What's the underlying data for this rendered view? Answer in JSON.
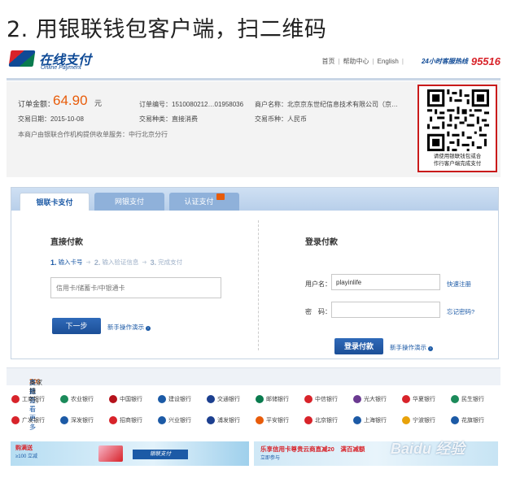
{
  "step_title": "2. 用银联钱包客户端，扫二维码",
  "header": {
    "logo_card_text": "UnionPay 银联",
    "logo_main": "在线支付",
    "logo_sub": "Online Payment",
    "links": [
      "首页",
      "帮助中心",
      "English"
    ],
    "hotline_label": "24小时客服热线",
    "hotline_number": "95516"
  },
  "order": {
    "amount_label": "订单金额：",
    "amount_value": "64.90",
    "amount_unit": "元",
    "order_no": "订单编号：1510080212…01958036",
    "merchant": "商户名称：北京京东世纪信息技术有限公司（京…",
    "date": "交易日期：2015-10-08",
    "type": "交易种类：直接消费",
    "currency": "交易币种：人民币",
    "notice": "本商户由银联合作机构提供收单服务：中行北京分行",
    "qr_caption_1": "请使用银联钱包或合",
    "qr_caption_2": "作行客户端完成支付"
  },
  "tabs": [
    {
      "label": "银联卡支付",
      "active": true
    },
    {
      "label": "网银支付",
      "active": false
    },
    {
      "label": "认证支付",
      "active": false
    }
  ],
  "direct": {
    "title": "直接付款",
    "steps": [
      {
        "num": "1.",
        "label": "输入卡号"
      },
      {
        "num": "2.",
        "label": "输入验证信息"
      },
      {
        "num": "3.",
        "label": "完成支付"
      }
    ],
    "card_placeholder": "信用卡/储蓄卡/中银通卡",
    "next_label": "下一步",
    "help_label": "新手操作演示"
  },
  "login": {
    "title": "登录付款",
    "username_label": "用户名：",
    "username_value": "playinlife",
    "register_link": "快速注册",
    "password_label": "密　码：",
    "forgot_link": "忘记密码?",
    "submit_label": "登录付款",
    "help_label": "新手操作演示"
  },
  "banks": {
    "head_prefix": "支持",
    "head_count": "200",
    "head_suffix": "多家银行，",
    "head_more": "点此查看更多",
    "row1": [
      {
        "name": "工商银行",
        "color": "#d8232a"
      },
      {
        "name": "农业银行",
        "color": "#1b8a5a"
      },
      {
        "name": "中国银行",
        "color": "#b5121b"
      },
      {
        "name": "建设银行",
        "color": "#1b5aa6"
      },
      {
        "name": "交通银行",
        "color": "#1c3f8f"
      },
      {
        "name": "邮储银行",
        "color": "#0a7b4e"
      },
      {
        "name": "中信银行",
        "color": "#d8232a"
      },
      {
        "name": "光大银行",
        "color": "#6b3a91"
      },
      {
        "name": "华夏银行",
        "color": "#d8232a"
      },
      {
        "name": "民生银行",
        "color": "#1b8a5a"
      }
    ],
    "row2": [
      {
        "name": "广发银行",
        "color": "#d8232a"
      },
      {
        "name": "深发银行",
        "color": "#1c5aa6"
      },
      {
        "name": "招商银行",
        "color": "#d8232a"
      },
      {
        "name": "兴业银行",
        "color": "#1c5aa6"
      },
      {
        "name": "浦发银行",
        "color": "#1c3f8f"
      },
      {
        "name": "平安银行",
        "color": "#e85c0a"
      },
      {
        "name": "北京银行",
        "color": "#d8232a"
      },
      {
        "name": "上海银行",
        "color": "#1c5aa6"
      },
      {
        "name": "宁波银行",
        "color": "#e8a20a"
      },
      {
        "name": "花旗银行",
        "color": "#1c5aa6"
      }
    ]
  },
  "banners": {
    "left_t1": "购满送",
    "left_t2": "≥100 立减",
    "left_tag": "银联支付",
    "right_t1": "乐享信用卡尊贵云商直减20　满百减额",
    "right_t2": "立即参与"
  },
  "watermark": "Baidu 经验"
}
